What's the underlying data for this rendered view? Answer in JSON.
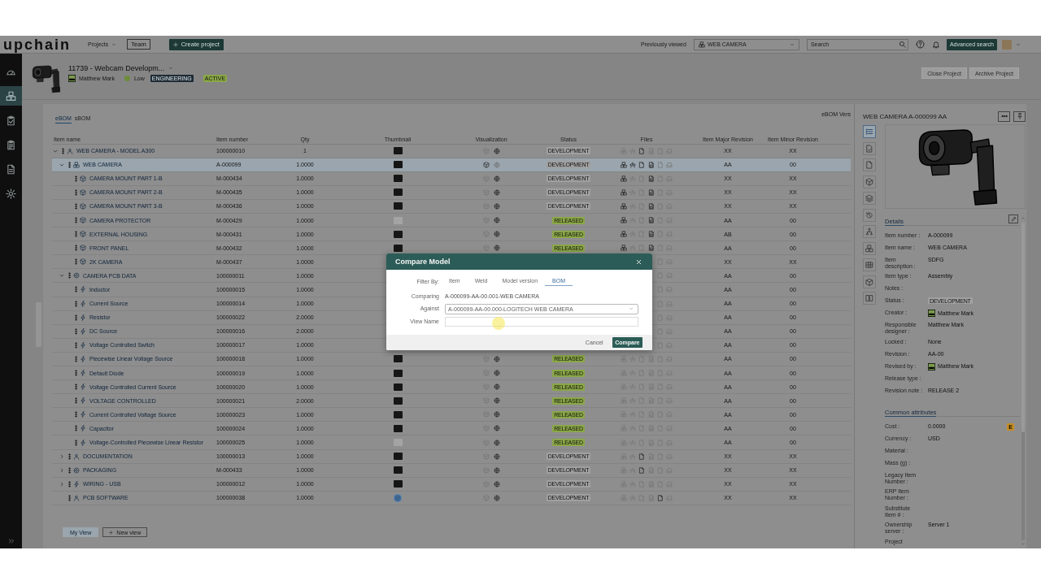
{
  "top_bar": {
    "logo": "upchain",
    "projects_menu": "Projects",
    "team_button": "Team",
    "create_button": "Create project",
    "previously_viewed_label": "Previously viewed",
    "previously_viewed": "WEB CAMERA",
    "search": {
      "placeholder": "Search"
    },
    "advanced_search_button": "Advanced search"
  },
  "nav": [
    {
      "kind": "gauge",
      "selected": false
    },
    {
      "kind": "cubes",
      "selected": true
    },
    {
      "kind": "clipboard-check",
      "selected": false
    },
    {
      "kind": "clipboard-list",
      "selected": false
    },
    {
      "kind": "document",
      "selected": false
    },
    {
      "kind": "gear",
      "selected": false
    }
  ],
  "project": {
    "title": "11739 - Webcam Developm...",
    "owner": "Matthew Mark",
    "priority": {
      "label": "Low",
      "color": "#6e8c3a"
    },
    "tags": [
      {
        "label": "ENGINEERING",
        "color": "#1e2b35"
      },
      {
        "label": "ACTIVE",
        "color": "#8aa746"
      }
    ],
    "buttons": [
      {
        "label": "Close Project",
        "disabled": true
      },
      {
        "label": "Archive Project",
        "disabled": true
      }
    ]
  },
  "bom_tabs": [
    {
      "label": "eBOM",
      "selected": true
    },
    {
      "label": "sBOM",
      "selected": false
    }
  ],
  "version_label": "eBOM Vers",
  "table": {
    "columns": [
      "Item name",
      "Item number",
      "Qty",
      "Thumbnail",
      "Visualization",
      "Status",
      "Files",
      "Item Major Revision",
      "Item Minor Revision"
    ],
    "rows": [
      {
        "name": "WEB CAMERA - MODEL A300",
        "kind": "person",
        "number": "100000010",
        "qty": "1",
        "thumbnail": {
          "kind": "dark"
        },
        "visualization": [
          false,
          true
        ],
        "status": {
          "text": "DEVELOPMENT",
          "color": "#a0a0a0"
        },
        "files": [
          false,
          false,
          true,
          false,
          false,
          false
        ],
        "major": "XX",
        "minor": "XX",
        "selected": false,
        "expanded": true,
        "children": [
          {
            "name": "WEB CAMERA",
            "kind": "cubes",
            "number": "A-000099",
            "qty": "1.0000",
            "thumbnail": {
              "kind": "dark"
            },
            "visualization": [
              true,
              false
            ],
            "status": {
              "text": "DEVELOPMENT",
              "color": "#a0a0a0"
            },
            "files": [
              true,
              true,
              true,
              true,
              false,
              false
            ],
            "major": "AA",
            "minor": "00",
            "selected": true,
            "expanded": true,
            "children": [
              {
                "name": "CAMERA MOUNT PART 1-B",
                "kind": "cube",
                "number": "M-000434",
                "qty": "1.0000",
                "thumbnail": {
                  "kind": "dark"
                },
                "visualization": [
                  false,
                  true
                ],
                "status": {
                  "text": "DEVELOPMENT",
                  "color": "#a0a0a0"
                },
                "files": [
                  true,
                  false,
                  false,
                  true,
                  false,
                  false
                ],
                "major": "XX",
                "minor": "XX",
                "selected": false
              },
              {
                "name": "CAMERA MOUNT PART 2-B",
                "kind": "cube",
                "number": "M-000435",
                "qty": "1.0000",
                "thumbnail": {
                  "kind": "dark"
                },
                "visualization": [
                  false,
                  true
                ],
                "status": {
                  "text": "DEVELOPMENT",
                  "color": "#a0a0a0"
                },
                "files": [
                  true,
                  false,
                  false,
                  true,
                  false,
                  false
                ],
                "major": "XX",
                "minor": "XX",
                "selected": false
              },
              {
                "name": "CAMERA MOUNT PART 3-B",
                "kind": "cube",
                "number": "M-000436",
                "qty": "1.0000",
                "thumbnail": {
                  "kind": "dark"
                },
                "visualization": [
                  false,
                  true
                ],
                "status": {
                  "text": "DEVELOPMENT",
                  "color": "#a0a0a0"
                },
                "files": [
                  true,
                  false,
                  false,
                  true,
                  false,
                  false
                ],
                "major": "XX",
                "minor": "XX",
                "selected": false
              },
              {
                "name": "CAMERA PROTECTOR",
                "kind": "cube",
                "number": "M-000429",
                "qty": "1.0000",
                "thumbnail": {
                  "kind": "light"
                },
                "visualization": [
                  false,
                  true
                ],
                "status": {
                  "text": "RELEASED",
                  "color": "#8aa746"
                },
                "files": [
                  true,
                  false,
                  false,
                  true,
                  false,
                  false
                ],
                "major": "AA",
                "minor": "00",
                "selected": false
              },
              {
                "name": "EXTERNAL HOUSING",
                "kind": "cube",
                "number": "M-000431",
                "qty": "1.0000",
                "thumbnail": {
                  "kind": "dark"
                },
                "visualization": [
                  false,
                  true
                ],
                "status": {
                  "text": "RELEASED",
                  "color": "#8aa746"
                },
                "files": [
                  true,
                  false,
                  false,
                  true,
                  false,
                  false
                ],
                "major": "AB",
                "minor": "00",
                "selected": false
              },
              {
                "name": "FRONT PANEL",
                "kind": "cube",
                "number": "M-000432",
                "qty": "1.0000",
                "thumbnail": {
                  "kind": "dark"
                },
                "visualization": [
                  false,
                  true
                ],
                "status": {
                  "text": "RELEASED",
                  "color": "#8aa746"
                },
                "files": [
                  true,
                  false,
                  false,
                  true,
                  false,
                  false
                ],
                "major": "AA",
                "minor": "00",
                "selected": false
              },
              {
                "name": "2K CAMERA",
                "kind": "cube",
                "number": "M-000437",
                "qty": "1.0000",
                "files": [
                  false,
                  false
                ],
                "major": "XX",
                "minor": "XX",
                "selected": false
              }
            ]
          },
          {
            "name": "CAMERA PCB DATA",
            "kind": "target",
            "number": "100000011",
            "qty": "1.0000",
            "files": [
              false,
              false
            ],
            "major": "AA",
            "minor": "00",
            "selected": false,
            "expanded": true,
            "children": [
              {
                "name": "Inductor",
                "kind": "bolt",
                "number": "100000015",
                "qty": "1.0000",
                "files": [
                  false,
                  false
                ],
                "major": "AA",
                "minor": "00",
                "selected": false
              },
              {
                "name": "Current Source",
                "kind": "bolt",
                "number": "100000014",
                "qty": "1.0000",
                "files": [
                  false,
                  false
                ],
                "major": "AA",
                "minor": "00",
                "selected": false
              },
              {
                "name": "Resistor",
                "kind": "bolt",
                "number": "100000022",
                "qty": "2.0000",
                "files": [
                  false,
                  false
                ],
                "major": "AA",
                "minor": "00",
                "selected": false
              },
              {
                "name": "DC Source",
                "kind": "bolt",
                "number": "100000016",
                "qty": "2.0000",
                "files": [
                  false,
                  false
                ],
                "major": "AA",
                "minor": "00",
                "selected": false
              },
              {
                "name": "Voltage Controlled Switch",
                "kind": "bolt",
                "number": "100000017",
                "qty": "1.0000",
                "files": [
                  false,
                  false
                ],
                "major": "AA",
                "minor": "00",
                "selected": false
              },
              {
                "name": "Piecewise Linear Voltage Source",
                "kind": "bolt",
                "number": "100000018",
                "qty": "1.0000",
                "thumbnail": {
                  "kind": "dark"
                },
                "visualization": [
                  false,
                  true
                ],
                "status": {
                  "text": "RELEASED",
                  "color": "#8aa746"
                },
                "files": [
                  false,
                  false,
                  false,
                  false,
                  false,
                  false
                ],
                "major": "AA",
                "minor": "00",
                "selected": false
              },
              {
                "name": "Default Diode",
                "kind": "bolt",
                "number": "100000019",
                "qty": "1.0000",
                "thumbnail": {
                  "kind": "dark"
                },
                "visualization": [
                  false,
                  true
                ],
                "status": {
                  "text": "RELEASED",
                  "color": "#8aa746"
                },
                "files": [
                  false,
                  false,
                  false,
                  false,
                  false,
                  false
                ],
                "major": "AA",
                "minor": "00",
                "selected": false
              },
              {
                "name": "Voltage Controlled Current Source",
                "kind": "bolt",
                "number": "100000020",
                "qty": "1.0000",
                "thumbnail": {
                  "kind": "dark"
                },
                "visualization": [
                  false,
                  true
                ],
                "status": {
                  "text": "RELEASED",
                  "color": "#8aa746"
                },
                "files": [
                  false,
                  false,
                  false,
                  false,
                  false,
                  false
                ],
                "major": "AA",
                "minor": "00",
                "selected": false
              },
              {
                "name": "VOLTAGE CONTROLLED",
                "kind": "bolt",
                "number": "100000021",
                "qty": "2.0000",
                "thumbnail": {
                  "kind": "dark"
                },
                "visualization": [
                  false,
                  true
                ],
                "status": {
                  "text": "RELEASED",
                  "color": "#8aa746"
                },
                "files": [
                  false,
                  false,
                  false,
                  false,
                  false,
                  false
                ],
                "major": "AA",
                "minor": "00",
                "selected": false
              },
              {
                "name": "Current Controlled Voltage Source",
                "kind": "bolt",
                "number": "100000023",
                "qty": "1.0000",
                "thumbnail": {
                  "kind": "dark"
                },
                "visualization": [
                  false,
                  true
                ],
                "status": {
                  "text": "RELEASED",
                  "color": "#8aa746"
                },
                "files": [
                  false,
                  false,
                  false,
                  false,
                  false,
                  false
                ],
                "major": "AA",
                "minor": "00",
                "selected": false
              },
              {
                "name": "Capacitor",
                "kind": "bolt",
                "number": "100000024",
                "qty": "1.0000",
                "thumbnail": {
                  "kind": "dark"
                },
                "visualization": [
                  false,
                  true
                ],
                "status": {
                  "text": "RELEASED",
                  "color": "#8aa746"
                },
                "files": [
                  false,
                  false,
                  false,
                  false,
                  false,
                  false
                ],
                "major": "AA",
                "minor": "00",
                "selected": false
              },
              {
                "name": "Voltage-Controlled Piecewise Linear Resistor",
                "kind": "bolt",
                "number": "100000025",
                "qty": "1.0000",
                "thumbnail": {
                  "kind": "light"
                },
                "visualization": [
                  false,
                  true
                ],
                "status": {
                  "text": "RELEASED",
                  "color": "#8aa746"
                },
                "files": [
                  false,
                  false,
                  false,
                  false,
                  false,
                  false
                ],
                "major": "AA",
                "minor": "00",
                "selected": false
              }
            ]
          },
          {
            "name": "DOCUMENTATION",
            "kind": "person",
            "number": "100000013",
            "qty": "1.0000",
            "thumbnail": {
              "kind": "dark"
            },
            "visualization": [
              false,
              true
            ],
            "status": {
              "text": "DEVELOPMENT",
              "color": "#a0a0a0"
            },
            "files": [
              false,
              false,
              true,
              false,
              false,
              false
            ],
            "major": "XX",
            "minor": "XX",
            "selected": false,
            "expanded": false
          },
          {
            "name": "PACKAGING",
            "kind": "target",
            "number": "M-000433",
            "qty": "1.0000",
            "thumbnail": {
              "kind": "dark"
            },
            "visualization": [
              false,
              true
            ],
            "status": {
              "text": "DEVELOPMENT",
              "color": "#a0a0a0"
            },
            "files": [
              false,
              false,
              true,
              false,
              false,
              false
            ],
            "major": "XX",
            "minor": "XX",
            "selected": false,
            "expanded": false
          },
          {
            "name": "WIRING - USB",
            "kind": "bolt",
            "number": "100000012",
            "qty": "1.0000",
            "thumbnail": {
              "kind": "dark"
            },
            "visualization": [
              false,
              true
            ],
            "status": {
              "text": "DEVELOPMENT",
              "color": "#a0a0a0"
            },
            "files": [
              false,
              false,
              false,
              false,
              false,
              false
            ],
            "major": "XX",
            "minor": "XX",
            "selected": false,
            "expanded": false
          },
          {
            "name": "PCB SOFTWARE",
            "kind": "person",
            "number": "100000038",
            "qty": "1.0000",
            "thumbnail": {
              "kind": "disc"
            },
            "visualization": [
              false,
              true
            ],
            "status": {
              "text": "DEVELOPMENT",
              "color": "#a0a0a0"
            },
            "files": [
              false,
              false,
              false,
              false,
              true,
              false
            ],
            "major": "XX",
            "minor": "XX",
            "selected": false
          }
        ]
      }
    ]
  },
  "views": [
    {
      "label": "My View",
      "selected": true
    }
  ],
  "new_view_button": "New view",
  "detail_panel": {
    "title": "WEB CAMERA A-000099 AA",
    "tabs": [
      {
        "kind": "list",
        "selected": true
      },
      {
        "kind": "file-check",
        "selected": false
      },
      {
        "kind": "file",
        "selected": false
      },
      {
        "kind": "cube",
        "selected": false
      },
      {
        "kind": "layers",
        "selected": false
      },
      {
        "kind": "history",
        "selected": false
      },
      {
        "kind": "tree",
        "selected": false
      },
      {
        "kind": "cubes",
        "selected": false
      },
      {
        "kind": "grid",
        "selected": false
      },
      {
        "kind": "box",
        "selected": false
      },
      {
        "kind": "columns",
        "selected": false
      }
    ],
    "details_heading": "Details",
    "details": [
      {
        "label": "Item number :",
        "kind": "text",
        "value": "A-000099"
      },
      {
        "label": "Item name :",
        "kind": "text",
        "value": "WEB CAMERA"
      },
      {
        "label": "Item description :",
        "kind": "text",
        "value": "SDFG"
      },
      {
        "label": "Item type :",
        "kind": "text",
        "value": "Assembly"
      },
      {
        "label": "Notes :"
      },
      {
        "label": "Status :",
        "kind": "badge",
        "value": "DEVELOPMENT",
        "color": "#a0a0a0"
      },
      {
        "label": "Creator :",
        "kind": "user",
        "value": "Matthew Mark"
      },
      {
        "label": "Responsible designer :",
        "kind": "text",
        "value": "Matthew Mark"
      },
      {
        "label": "Locked :",
        "kind": "text",
        "value": "None"
      },
      {
        "label": "Revision :",
        "kind": "text",
        "value": "AA-00"
      },
      {
        "label": "Revised by :",
        "kind": "user",
        "value": "Matthew Mark"
      },
      {
        "label": "Release type :"
      },
      {
        "label": "Revision note :",
        "kind": "text",
        "value": "RELEASE 2"
      }
    ],
    "attributes_heading": "Common attributes",
    "attributes": [
      {
        "label": "Cost :",
        "kind": "text",
        "value": "0.0000",
        "flag": "E"
      },
      {
        "label": "Currency :",
        "kind": "text",
        "value": "USD"
      },
      {
        "label": "Material :"
      },
      {
        "label": "Mass (g) :"
      },
      {
        "label": "Legacy Item Number :"
      },
      {
        "label": "ERP Item Number :"
      },
      {
        "label": "Substitute Item # :"
      },
      {
        "label": "Ownership server :",
        "kind": "text",
        "value": "Server 1"
      },
      {
        "label": "Project"
      }
    ]
  },
  "dialog": {
    "title": "Compare Model",
    "filter_label": "Filter By:",
    "filters": [
      {
        "label": "Item",
        "selected": false
      },
      {
        "label": "Weld",
        "selected": false
      },
      {
        "label": "Model version",
        "selected": false
      },
      {
        "label": "BOM",
        "selected": true
      }
    ],
    "fields": [
      {
        "label": "Comparing",
        "kind": "static",
        "value": "A-000099-AA-00.001-WEB CAMERA"
      },
      {
        "label": "Against",
        "kind": "select",
        "value": "A-000099-AA-00.000-LOGITECH WEB CAMERA"
      },
      {
        "label": "View Name",
        "kind": "input"
      }
    ],
    "buttons": [
      {
        "label": "Cancel",
        "kind": "link"
      },
      {
        "label": "Compare",
        "kind": "primary"
      }
    ]
  }
}
